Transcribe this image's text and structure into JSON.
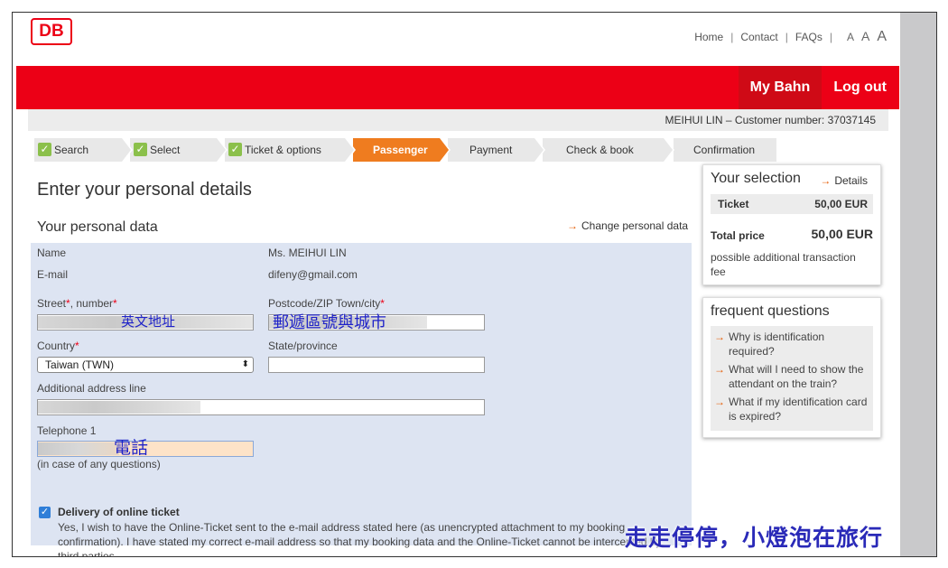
{
  "header": {
    "logo": "DB",
    "nav": [
      "Home",
      "Contact",
      "FAQs"
    ],
    "font_sizes": [
      "A",
      "A",
      "A"
    ],
    "my_bahn": "My Bahn",
    "log_out": "Log out"
  },
  "customer_line": "MEIHUI LIN – Customer number: 37037145",
  "steps": [
    {
      "label": "Search",
      "state": "done"
    },
    {
      "label": "Select",
      "state": "done"
    },
    {
      "label": "Ticket & options",
      "state": "done"
    },
    {
      "label": "Passenger",
      "state": "active"
    },
    {
      "label": "Payment",
      "state": "pending"
    },
    {
      "label": "Check & book",
      "state": "pending"
    },
    {
      "label": "Confirmation",
      "state": "pending"
    }
  ],
  "page_title": "Enter your personal details",
  "section_title": "Your personal data",
  "change_link": "Change personal data",
  "form": {
    "name_label": "Name",
    "name_value": "Ms. MEIHUI LIN",
    "email_label": "E-mail",
    "email_value": "difeny@gmail.com",
    "street_label": "Street",
    "street_label2": ", number",
    "postcode_label": "Postcode/ZIP  Town/city",
    "country_label": "Country",
    "country_value": "Taiwan (TWN)",
    "state_label": "State/province",
    "additional_label": "Additional address line",
    "telephone_label": "Telephone 1",
    "telephone_hint": "(in case of any questions)",
    "delivery_title": "Delivery of online ticket",
    "delivery_text": "Yes, I wish to have the Online-Ticket sent to the e-mail address stated here (as unencrypted attachment to my booking confirmation). I have stated my correct e-mail address so that my booking data and the Online-Ticket cannot be intercepted by third parties."
  },
  "annotations": {
    "street": "英文地址",
    "postcode": "郵遞區號與城市",
    "phone": "電話"
  },
  "selection": {
    "title": "Your selection",
    "details": "Details",
    "ticket_label": "Ticket",
    "ticket_price": "50,00 EUR",
    "total_label": "Total price",
    "total_price": "50,00 EUR",
    "fee_note": "possible additional transaction fee"
  },
  "faq": {
    "title": "frequent questions",
    "items": [
      "Why is identification required?",
      "What will I need to show the attendant on the train?",
      "What if my identification card is expired?"
    ]
  },
  "watermark": "走走停停，小燈泡在旅行",
  "colors": {
    "brand_red": "#ec0016",
    "active_step": "#ef7c1f",
    "form_bg": "#dde4f2"
  }
}
